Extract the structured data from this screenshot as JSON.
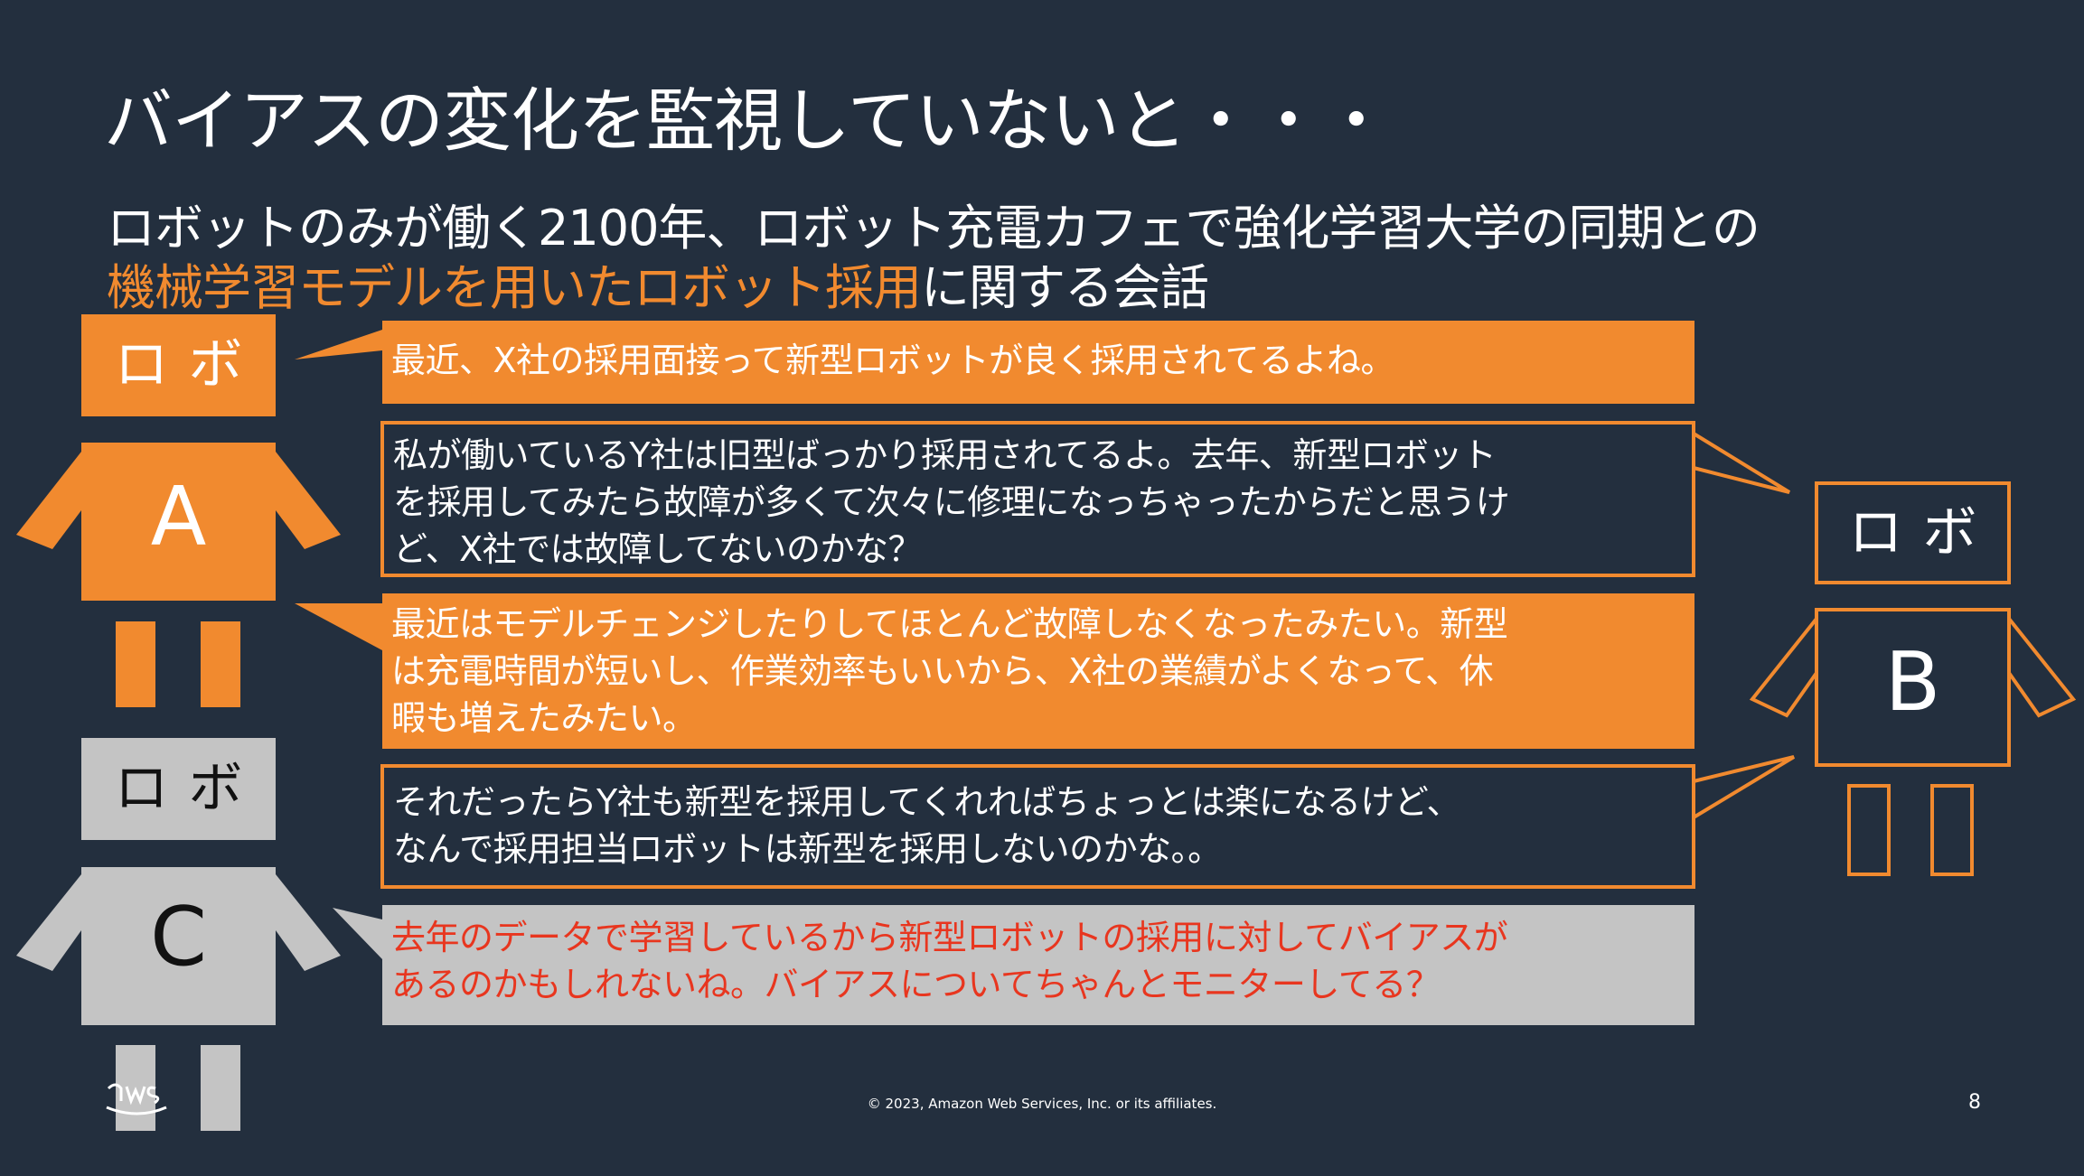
{
  "title": "バイアスの変化を監視していないと・・・",
  "subtitle": {
    "line1": "ロボットのみが働く2100年、ロボット充電カフェで強化学習大学の同期との",
    "line2_highlight": "機械学習モデルを用いたロボット採用",
    "line2_rest": "に関する会話"
  },
  "robots": {
    "a": {
      "label": "ロボ",
      "letter": "A",
      "color": "#f18a2f"
    },
    "b": {
      "label": "ロボ",
      "letter": "B",
      "color": "#f18a2f"
    },
    "c": {
      "label": "ロボ",
      "letter": "C",
      "color": "#c4c4c4"
    }
  },
  "dialog": [
    {
      "speaker": "A",
      "lines": [
        "最近、X社の採用面接って新型ロボットが良く採用されてるよね。"
      ]
    },
    {
      "speaker": "B",
      "lines": [
        "私が働いているY社は旧型ばっかり採用されてるよ。去年、新型ロボット",
        "を採用してみたら故障が多くて次々に修理になっちゃったからだと思うけ",
        "ど、X社では故障してないのかな？"
      ]
    },
    {
      "speaker": "A",
      "lines": [
        "最近はモデルチェンジしたりしてほとんど故障しなくなったみたい。新型",
        "は充電時間が短いし、作業効率もいいから、X社の業績がよくなって、休",
        "暇も増えたみたい。"
      ]
    },
    {
      "speaker": "B",
      "lines": [
        "それだったらY社も新型を採用してくれればちょっとは楽になるけど、",
        "なんで採用担当ロボットは新型を採用しないのかな。。"
      ]
    },
    {
      "speaker": "C",
      "lines": [
        "去年のデータで学習しているから新型ロボットの採用に対してバイアスが",
        "あるのかもしれないね。バイアスについてちゃんとモニターしてる？"
      ]
    }
  ],
  "colors": {
    "background": "#232f3e",
    "accent": "#f18a2f",
    "gray": "#c4c4c4",
    "warning_text": "#e8361f"
  },
  "footer": {
    "logo": "aws",
    "copyright": "© 2023, Amazon Web Services, Inc. or its affiliates.",
    "page": "8"
  }
}
